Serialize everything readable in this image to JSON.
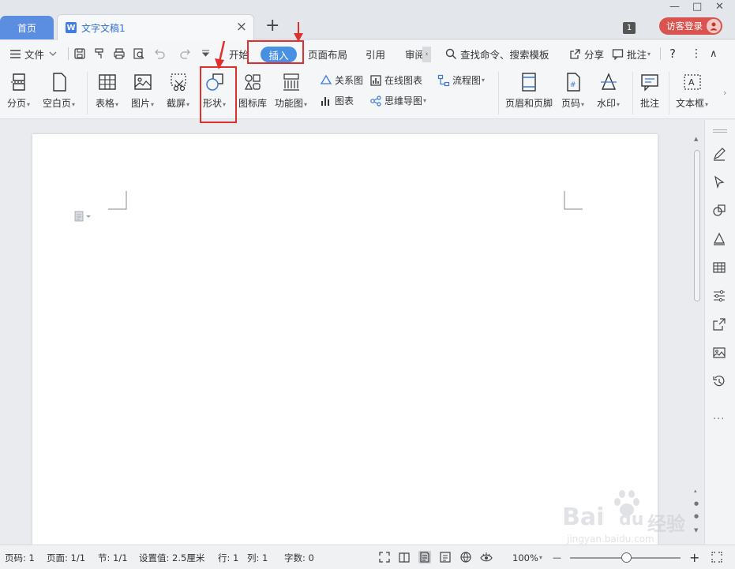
{
  "tabs": {
    "home_label": "首页",
    "doc_label": "文字文稿1",
    "doc_icon_letter": "W",
    "close_glyph": "×",
    "add_glyph": "+"
  },
  "window": {
    "badge_count": "1",
    "login_label": "访客登录",
    "min_glyph": "—",
    "max_glyph": "□",
    "close_glyph": "✕"
  },
  "menu": {
    "file_label": "文件",
    "start_label": "开始",
    "insert_label": "插入",
    "layout_label": "页面布局",
    "reference_label": "引用",
    "review_label": "审阅",
    "search_label": "查找命令、搜索模板",
    "share_label": "分享",
    "comment_label": "批注",
    "help_glyph": "?",
    "more_glyph": "⋮",
    "collapse_glyph": "∧"
  },
  "ribbon": {
    "page_break": "分页",
    "blank_page": "空白页",
    "table": "表格",
    "picture": "图片",
    "screenshot": "截屏",
    "shape": "形状",
    "icon_lib": "图标库",
    "func_chart": "功能图",
    "relation_chart": "关系图",
    "online_chart": "在线图表",
    "chart": "图表",
    "mindmap": "思维导图",
    "flowchart": "流程图",
    "header_footer": "页眉和页脚",
    "page_number": "页码",
    "watermark": "水印",
    "comment": "批注",
    "textbox": "文本框"
  },
  "status": {
    "page_num": "页码: 1",
    "pages": "页面: 1/1",
    "section": "节: 1/1",
    "setting": "设置值: 2.5厘米",
    "row": "行: 1",
    "col": "列: 1",
    "word_count": "字数: 0",
    "zoom": "100%",
    "zoom_minus": "—",
    "zoom_plus": "+"
  },
  "watermark_text": {
    "brand": "Bai",
    "brand2": "du",
    "cn": "经验",
    "url": "jingyan.baidu.com"
  },
  "colors": {
    "accent": "#4a90e2",
    "highlight": "#e0302e",
    "home_tab": "#5b8de0",
    "login": "#d9534f"
  }
}
